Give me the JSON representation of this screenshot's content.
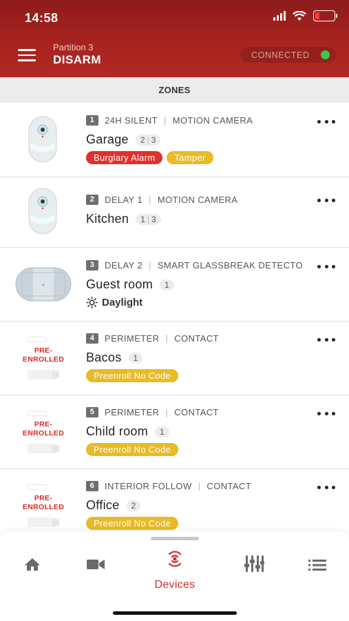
{
  "status_bar": {
    "time": "14:58"
  },
  "header": {
    "partition_label": "Partition 3",
    "partition_state": "DISARM",
    "connection_status": "CONNECTED"
  },
  "section": {
    "title": "ZONES"
  },
  "zones": [
    {
      "number": "1",
      "type": "24H SILENT",
      "device": "MOTION CAMERA",
      "name": "Garage",
      "chip": [
        "2",
        "3"
      ],
      "tags": [
        "Burglary Alarm",
        "Tamper"
      ]
    },
    {
      "number": "2",
      "type": "DELAY 1",
      "device": "MOTION CAMERA",
      "name": "Kitchen",
      "chip": [
        "1",
        "3"
      ]
    },
    {
      "number": "3",
      "type": "DELAY 2",
      "device": "SMART GLASSBREAK DETECTO",
      "name": "Guest room",
      "chip": [
        "1"
      ],
      "status": "Daylight"
    },
    {
      "number": "4",
      "type": "PERIMETER",
      "device": "CONTACT",
      "name": "Bacos",
      "chip": [
        "1"
      ],
      "tags": [
        "Preenroll No Code"
      ],
      "image_label": [
        "PRE-",
        "ENROLLED"
      ]
    },
    {
      "number": "5",
      "type": "PERIMETER",
      "device": "CONTACT",
      "name": "Child room",
      "chip": [
        "1"
      ],
      "tags": [
        "Preenroll No Code"
      ],
      "image_label": [
        "PRE-",
        "ENROLLED"
      ]
    },
    {
      "number": "6",
      "type": "INTERIOR FOLLOW",
      "device": "CONTACT",
      "name": "Office",
      "chip": [
        "2"
      ],
      "tags": [
        "Preenroll No Code"
      ],
      "image_label": [
        "PRE-",
        "ENROLLED"
      ]
    }
  ],
  "tabbar": {
    "tabs": [
      {
        "icon": "home-icon",
        "label": ""
      },
      {
        "icon": "video-camera-icon",
        "label": ""
      },
      {
        "icon": "devices-icon",
        "label": "Devices",
        "active": true
      },
      {
        "icon": "equalizer-icon",
        "label": ""
      },
      {
        "icon": "list-icon",
        "label": ""
      }
    ]
  },
  "colors": {
    "brand_red": "#a8231f",
    "alarm_red": "#e0302c",
    "warning_yellow": "#e8bb27",
    "connected_green": "#3cc84a"
  }
}
